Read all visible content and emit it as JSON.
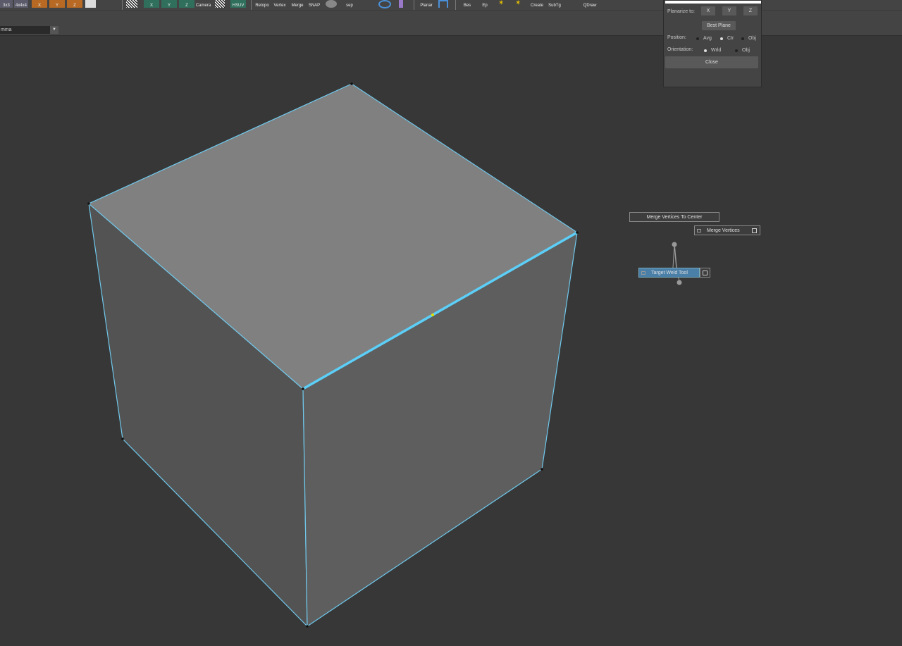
{
  "shelf": {
    "buttons": [
      {
        "label": "3x3"
      },
      {
        "label": "4x4x4"
      },
      {
        "label": "X"
      },
      {
        "label": "Y"
      },
      {
        "label": "Z"
      },
      {
        "label": "X"
      },
      {
        "label": "Y"
      },
      {
        "label": "Z"
      },
      {
        "label": "Camera"
      },
      {
        "label": "HSUV"
      },
      {
        "label": "Retopo"
      },
      {
        "label": "Vertex"
      },
      {
        "label": "Merge"
      },
      {
        "label": "SNAP"
      },
      {
        "label": "sep"
      },
      {
        "label": "Planar"
      },
      {
        "label": "Bes"
      },
      {
        "label": "Ep"
      },
      {
        "label": "Create"
      },
      {
        "label": "SubTg"
      },
      {
        "label": "QDraw"
      }
    ],
    "icons": [
      "checker-icon",
      "uv-snap-icon",
      "sphere-icon",
      "qr-ring-icon",
      "bevel-icon",
      "light-icon"
    ]
  },
  "toolbar": {
    "camera_select": "mma"
  },
  "planarize": {
    "planarize_to_label": "Planarize to:",
    "x_label": "X",
    "y_label": "Y",
    "z_label": "Z",
    "best_plane_label": "Best Plane",
    "position_label": "Position:",
    "position_options": [
      "Avg",
      "Ctr",
      "Obj"
    ],
    "position_selected": "Ctr",
    "orientation_label": "Orientation:",
    "orientation_options": [
      "Wrld",
      "Obj"
    ],
    "orientation_selected": "Wrld",
    "close_label": "Close"
  },
  "hotbox": {
    "merge_center": "Merge Vertices To Center",
    "merge_vertices": "Merge Vertices",
    "target_weld": "Target Weld Tool"
  },
  "colors": {
    "viewport_bg": "#373737",
    "top_face": "#808080",
    "left_face": "#535353",
    "right_face": "#5e5e5e",
    "edge": "#6fc8ec",
    "selected_edge": "#5ccff8",
    "marker": "#e0e000"
  }
}
